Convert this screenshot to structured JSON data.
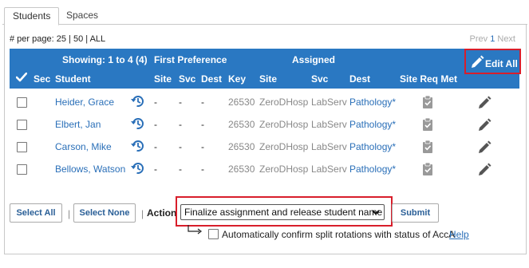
{
  "tabs": [
    {
      "label": "Students",
      "active": true
    },
    {
      "label": "Spaces",
      "active": false
    }
  ],
  "paging": {
    "label": "# per page:",
    "opt_25": "25",
    "sep1": "|",
    "opt_50": "50",
    "sep2": "|",
    "opt_all": "ALL",
    "prev": "Prev",
    "page": "1",
    "next": "Next"
  },
  "table": {
    "showing": "Showing: 1 to 4 (4)",
    "group_first_pref": "First Preference",
    "group_assigned": "Assigned",
    "edit_all": "Edit All",
    "columns": {
      "sec": "Sec",
      "student": "Student",
      "site": "Site",
      "svc": "Svc",
      "dest": "Dest",
      "key": "Key",
      "a_site": "Site",
      "a_svc": "Svc",
      "a_dest": "Dest",
      "site_req_met": "Site Req Met"
    },
    "rows": [
      {
        "student": "Heider, Grace",
        "site": "-",
        "svc": "-",
        "dest": "-",
        "key": "26530",
        "a_site": "ZeroDHosp",
        "a_svc": "LabServ",
        "a_dest": "Pathology*"
      },
      {
        "student": "Elbert, Jan",
        "site": "-",
        "svc": "-",
        "dest": "-",
        "key": "26530",
        "a_site": "ZeroDHosp",
        "a_svc": "LabServ",
        "a_dest": "Pathology*"
      },
      {
        "student": "Carson, Mike",
        "site": "-",
        "svc": "-",
        "dest": "-",
        "key": "26530",
        "a_site": "ZeroDHosp",
        "a_svc": "LabServ",
        "a_dest": "Pathology*"
      },
      {
        "student": "Bellows, Watson",
        "site": "-",
        "svc": "-",
        "dest": "-",
        "key": "26530",
        "a_site": "ZeroDHosp",
        "a_svc": "LabServ",
        "a_dest": "Pathology*"
      }
    ]
  },
  "controls": {
    "select_all": "Select All",
    "sep": "|",
    "select_none": "Select None",
    "action_label": "Action",
    "action_value": "Finalize assignment and release student name",
    "submit": "Submit",
    "auto_confirm": "Automatically confirm split rotations with status of AccA",
    "help": "Help"
  },
  "colors": {
    "header_bg": "#2a78c2",
    "link": "#2a6fb8",
    "highlight": "#d81e2b"
  },
  "icons": [
    "check-icon",
    "pencil-icon",
    "history-icon",
    "clipboard-check-icon",
    "chevron-down-icon",
    "return-arrow-icon"
  ]
}
